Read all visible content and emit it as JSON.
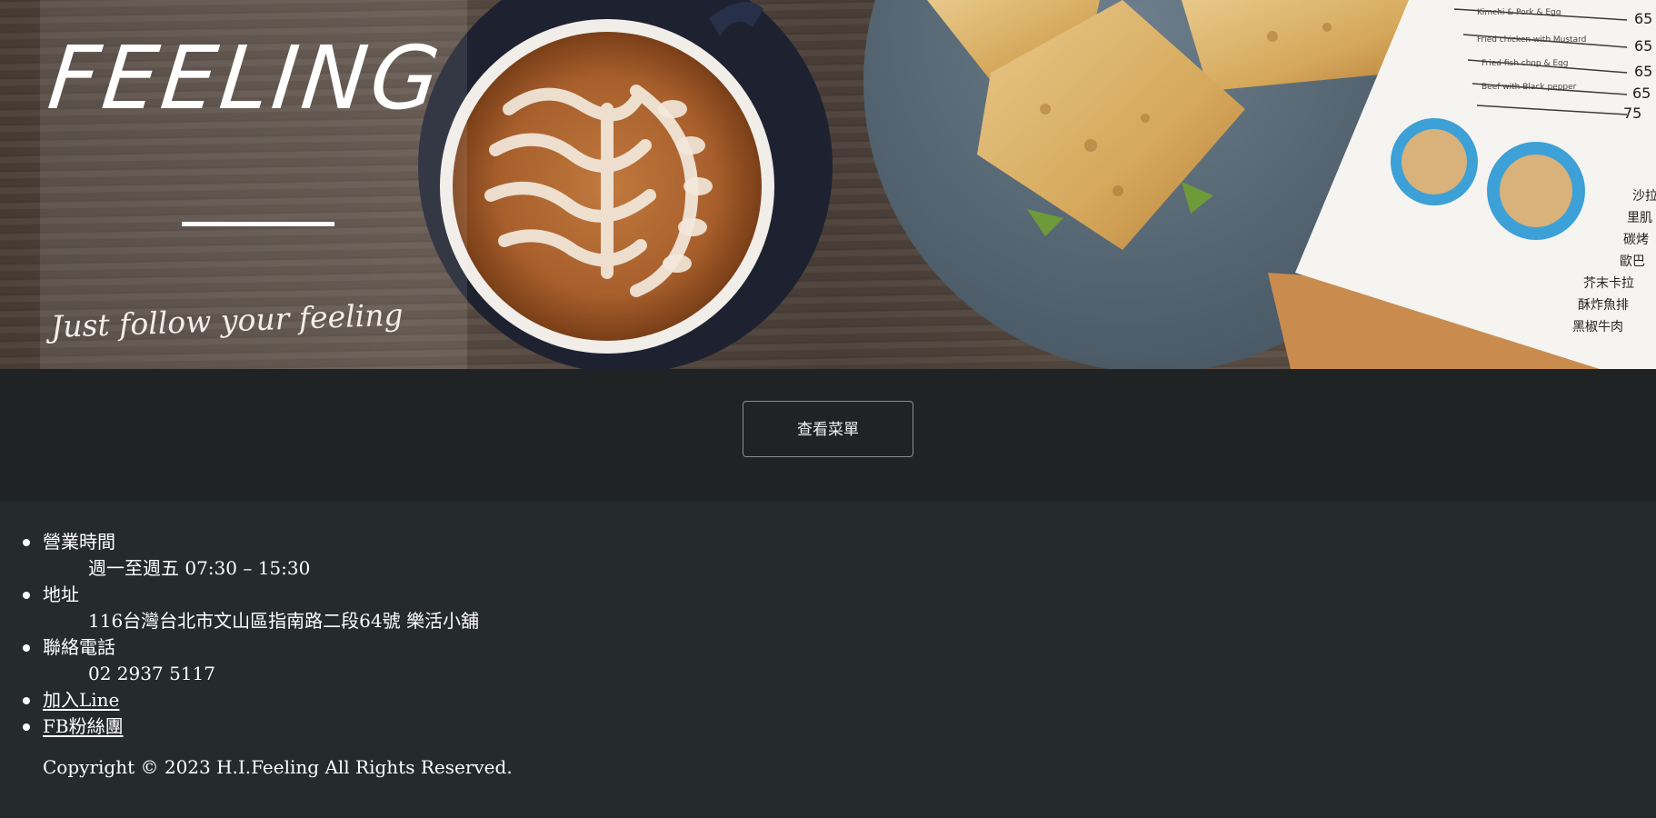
{
  "hero": {
    "title": "FEELING",
    "tagline": "Just follow your feeling",
    "menu_prices": [
      "65",
      "65",
      "65",
      "65",
      "75"
    ],
    "menu_item_notes": [
      "Kimchi & Pork & Egg",
      "Fried chicken with Mustard",
      "Fried fish chop & Egg",
      "Beef with Black pepper"
    ],
    "menu_item_names": [
      "沙拉",
      "里肌",
      "碳烤",
      "歐巴",
      "芥末卡拉",
      "酥炸魚排",
      "黑椒牛肉"
    ]
  },
  "cta": {
    "menu_button_label": "查看菜單"
  },
  "footer": {
    "items": [
      {
        "label": "營業時間",
        "value": "週一至週五 07:30 – 15:30"
      },
      {
        "label": "地址",
        "value": "116台灣台北市文山區指南路二段64號 樂活小舖"
      },
      {
        "label": "聯絡電話",
        "value": "02 2937 5117"
      }
    ],
    "links": [
      {
        "label": "加入Line"
      },
      {
        "label": "FB粉絲團"
      }
    ],
    "copyright": "Copyright © 2023 H.I.Feeling All Rights Reserved."
  },
  "colors": {
    "page_background": "#252a2b",
    "cta_band_background": "#202324",
    "text": "#ffffff",
    "button_border": "#8b8f91"
  }
}
